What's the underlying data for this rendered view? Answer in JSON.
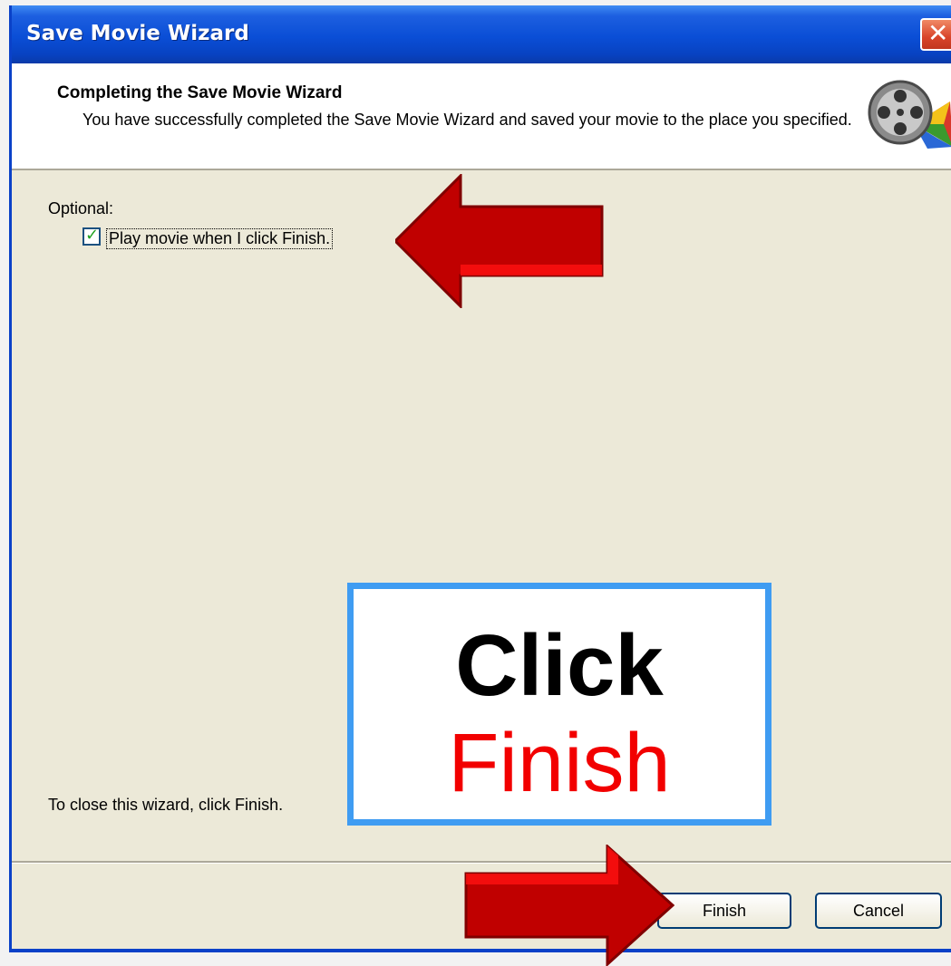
{
  "window": {
    "title": "Save Movie Wizard"
  },
  "header": {
    "title": "Completing the Save Movie Wizard",
    "subtitle": "You have successfully completed the Save Movie Wizard and saved your movie to the place you specified."
  },
  "body": {
    "optional_label": "Optional:",
    "checkbox_label": "Play movie when I click Finish.",
    "checkbox_checked": true,
    "close_text": "To close this wizard, click Finish."
  },
  "buttons": {
    "finish": "Finish",
    "cancel": "Cancel"
  },
  "callout": {
    "line1": "Click",
    "line2": "Finish"
  },
  "colors": {
    "titlebar": "#0a4ed6",
    "dialog_bg": "#ece9d8",
    "arrow": "#c00000",
    "callout_border": "#3f9cf2",
    "callout_accent": "#f20000"
  }
}
